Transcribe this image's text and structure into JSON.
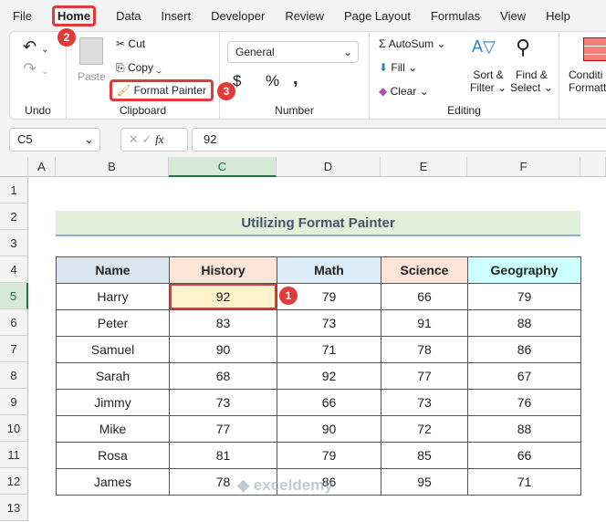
{
  "menu": [
    "File",
    "Home",
    "Data",
    "Insert",
    "Developer",
    "Review",
    "Page Layout",
    "Formulas",
    "View",
    "Help"
  ],
  "ribbon": {
    "undo_label": "Undo",
    "paste": "Paste",
    "cut": "Cut",
    "copy": "Copy",
    "format_painter": "Format Painter",
    "clipboard_label": "Clipboard",
    "number_format": "General",
    "currency": "$",
    "percent": "%",
    "comma": ",",
    "number_label": "Number",
    "autosum": "AutoSum",
    "fill": "Fill",
    "clear": "Clear",
    "sort_filter_1": "Sort &",
    "sort_filter_2": "Filter",
    "find_select_1": "Find &",
    "find_select_2": "Select",
    "editing_label": "Editing",
    "cond_1": "Conditi",
    "cond_2": "Formatti"
  },
  "badges": {
    "home": "2",
    "format_painter": "3",
    "cell": "1"
  },
  "formula_bar": {
    "name_box": "C5",
    "fx": "fx",
    "value": "92"
  },
  "columns": [
    "A",
    "B",
    "C",
    "D",
    "E",
    "F"
  ],
  "rows": [
    "1",
    "2",
    "3",
    "4",
    "5",
    "6",
    "7",
    "8",
    "9",
    "10",
    "11",
    "12",
    "13"
  ],
  "title": "Utilizing Format Painter",
  "table": {
    "headers": [
      "Name",
      "History",
      "Math",
      "Science",
      "Geography"
    ],
    "rows": [
      [
        "Harry",
        "92",
        "79",
        "66",
        "79"
      ],
      [
        "Peter",
        "83",
        "73",
        "91",
        "88"
      ],
      [
        "Samuel",
        "90",
        "71",
        "78",
        "86"
      ],
      [
        "Sarah",
        "68",
        "92",
        "77",
        "67"
      ],
      [
        "Jimmy",
        "73",
        "66",
        "73",
        "76"
      ],
      [
        "Mike",
        "77",
        "90",
        "72",
        "88"
      ],
      [
        "Rosa",
        "81",
        "79",
        "85",
        "66"
      ],
      [
        "James",
        "78",
        "86",
        "95",
        "71"
      ]
    ]
  },
  "header_colors": [
    "#dce6f1",
    "#fce4d6",
    "#ddebf7",
    "#fce4d6",
    "#ccffff"
  ],
  "selected_cell_color": "#fff2cc",
  "watermark": "exceldemy EXCEL · DATA · BI"
}
